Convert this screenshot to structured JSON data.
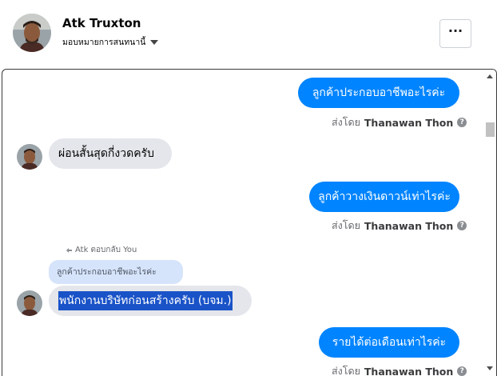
{
  "header": {
    "name": "Atk Truxton",
    "subtitle": "มอบหมายการสนทนานี้",
    "more_label": "···"
  },
  "messages": [
    {
      "type": "outgoing",
      "text": "ลูกค้าประกอบอาชีพอะไรค่ะ"
    },
    {
      "type": "sent_by",
      "prefix": "ส่งโดย",
      "author": "Thanawan Thon",
      "info": "?"
    },
    {
      "type": "incoming",
      "text": "ผ่อนสั้นสุดกี่งวดครับ"
    },
    {
      "type": "outgoing",
      "text": "ลูกค้าวางเงินดาวน์เท่าไรค่ะ"
    },
    {
      "type": "sent_by",
      "prefix": "ส่งโดย",
      "author": "Thanawan Thon",
      "info": "?"
    },
    {
      "type": "reply_label",
      "text": "Atk ตอบกลับ You"
    },
    {
      "type": "quoted",
      "text": "ลูกค้าประกอบอาชีพอะไรค่ะ"
    },
    {
      "type": "incoming_selected",
      "text": "พนักงานบริษัทก่อนสร้างครับ (บจม.)"
    },
    {
      "type": "outgoing",
      "text": "รายได้ต่อเดือนเท่าไรค่ะ"
    },
    {
      "type": "sent_by",
      "prefix": "ส่งโดย",
      "author": "Thanawan Thon",
      "info": "?"
    }
  ],
  "icons": {
    "header_avatar": "user-avatar",
    "reply": "reply-arrow-icon",
    "info": "info-icon",
    "caret": "caret-down-icon"
  }
}
